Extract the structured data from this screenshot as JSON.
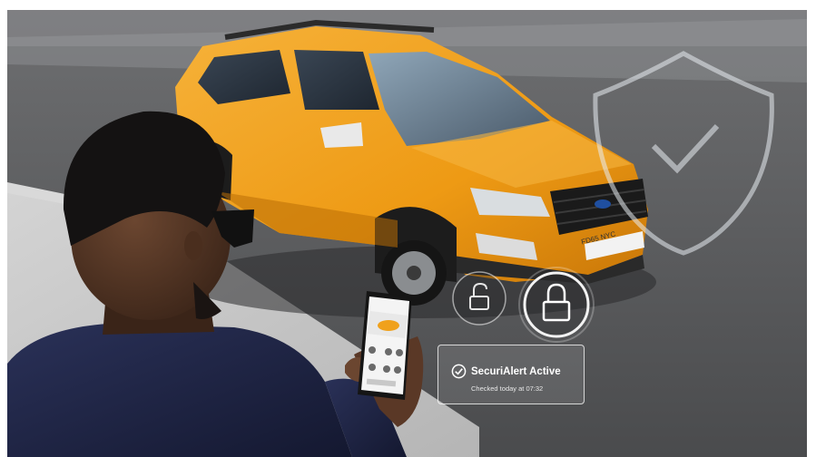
{
  "scene": {
    "background_colors": {
      "road": "#5d5e60",
      "pavement": "#bfbfbf",
      "car_body": "#f0a11c",
      "jacket": "#1d2340"
    },
    "icons": [
      "shield-check-icon",
      "unlock-icon",
      "lock-icon",
      "check-circle-icon"
    ]
  },
  "car": {
    "plate": "FD65 NYC"
  },
  "securialert": {
    "title": "SecuriAlert Active",
    "subtitle": "Checked today at 07:32"
  }
}
